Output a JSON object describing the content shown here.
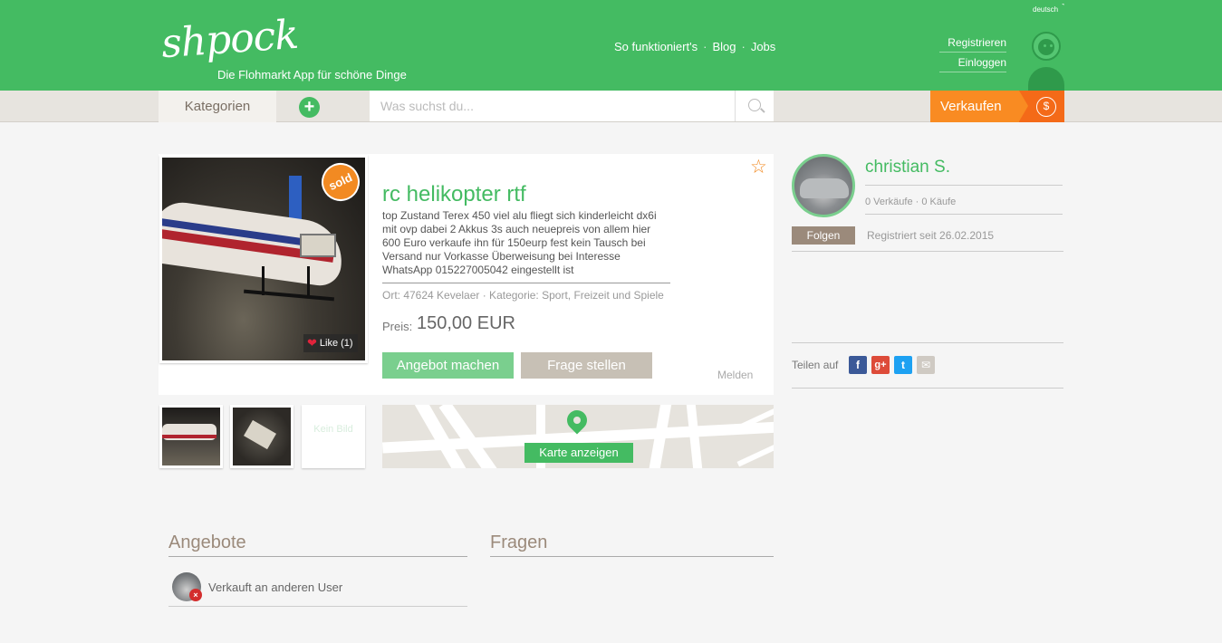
{
  "header": {
    "logo": "shpock",
    "tagline": "Die Flohmarkt App für schöne Dinge",
    "language": "deutsch",
    "nav": [
      {
        "label": "So funktioniert's"
      },
      {
        "label": "Blog"
      },
      {
        "label": "Jobs"
      }
    ],
    "nav_separator": "·",
    "register": "Registrieren",
    "login": "Einloggen"
  },
  "toolbar": {
    "categories": "Kategorien",
    "add": "+",
    "search_placeholder": "Was suchst du...",
    "sell": "Verkaufen",
    "sell_icon_symbol": "$"
  },
  "listing": {
    "status_badge": "sold",
    "like": {
      "heart": "❤",
      "label": "Like (1)"
    },
    "title": "rc helikopter rtf",
    "description": "top Zustand Terex 450 viel alu fliegt sich kinderleicht dx6i mit ovp dabei 2 Akkus 3s auch neuepreis von allem hier 600 Euro verkaufe ihn für 150eurp fest kein Tausch bei Versand nur Vorkasse Überweisung bei Interesse WhatsApp 015227005042 eingestellt ist",
    "meta": "Ort: 47624 Kevelaer · Kategorie: Sport, Freizeit und Spiele",
    "price_label": "Preis:",
    "price": "150,00 EUR",
    "offer_button": "Angebot machen",
    "question_button": "Frage stellen",
    "report": "Melden",
    "favorite_symbol": "☆",
    "no_image": "Kein Bild",
    "map_button": "Karte anzeigen"
  },
  "seller": {
    "name": "christian S.",
    "stats": "0 Verkäufe · 0 Käufe",
    "follow": "Folgen",
    "registered": "Registriert seit 26.02.2015",
    "share_label": "Teilen auf",
    "share": [
      {
        "name": "facebook",
        "glyph": "f",
        "color": "#3b5998"
      },
      {
        "name": "google-plus",
        "glyph": "g+",
        "color": "#dd4b39"
      },
      {
        "name": "twitter",
        "glyph": "t",
        "color": "#1da1f2"
      },
      {
        "name": "email",
        "glyph": "✉",
        "color": "#cfcac3"
      }
    ]
  },
  "bottom": {
    "offers_title": "Angebote",
    "questions_title": "Fragen",
    "offer_x": "×",
    "offer_text": "Verkauft an anderen User"
  },
  "colors": {
    "brand_green": "#44bb62",
    "sell_orange": "#f98b22",
    "sold_orange": "#f28a22",
    "brown": "#9b8a7b"
  }
}
